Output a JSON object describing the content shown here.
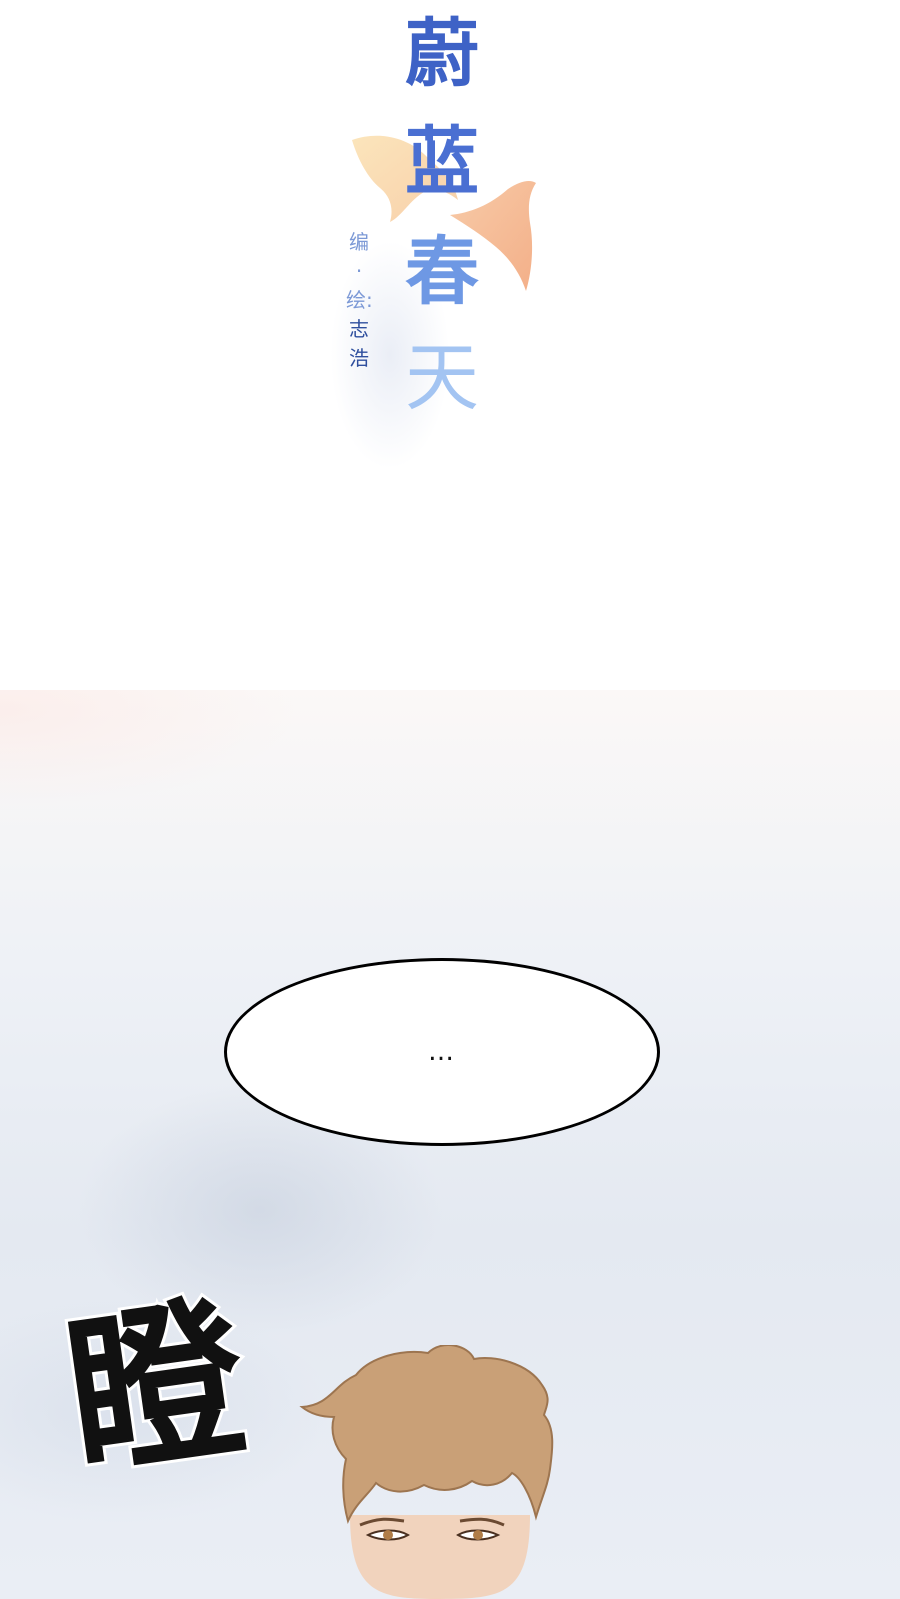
{
  "title": {
    "chars": [
      "蔚",
      "蓝",
      "春",
      "天"
    ],
    "credit": "编·绘:",
    "author": "志浩"
  },
  "speech_bubble": {
    "text": "…"
  },
  "sound_effect": {
    "text": "瞪"
  },
  "colors": {
    "title_dark_blue": "#3e62c6",
    "title_light_blue": "#a3c4f2",
    "fish_orange": "#f5b486",
    "hair_brown": "#c9a077"
  }
}
